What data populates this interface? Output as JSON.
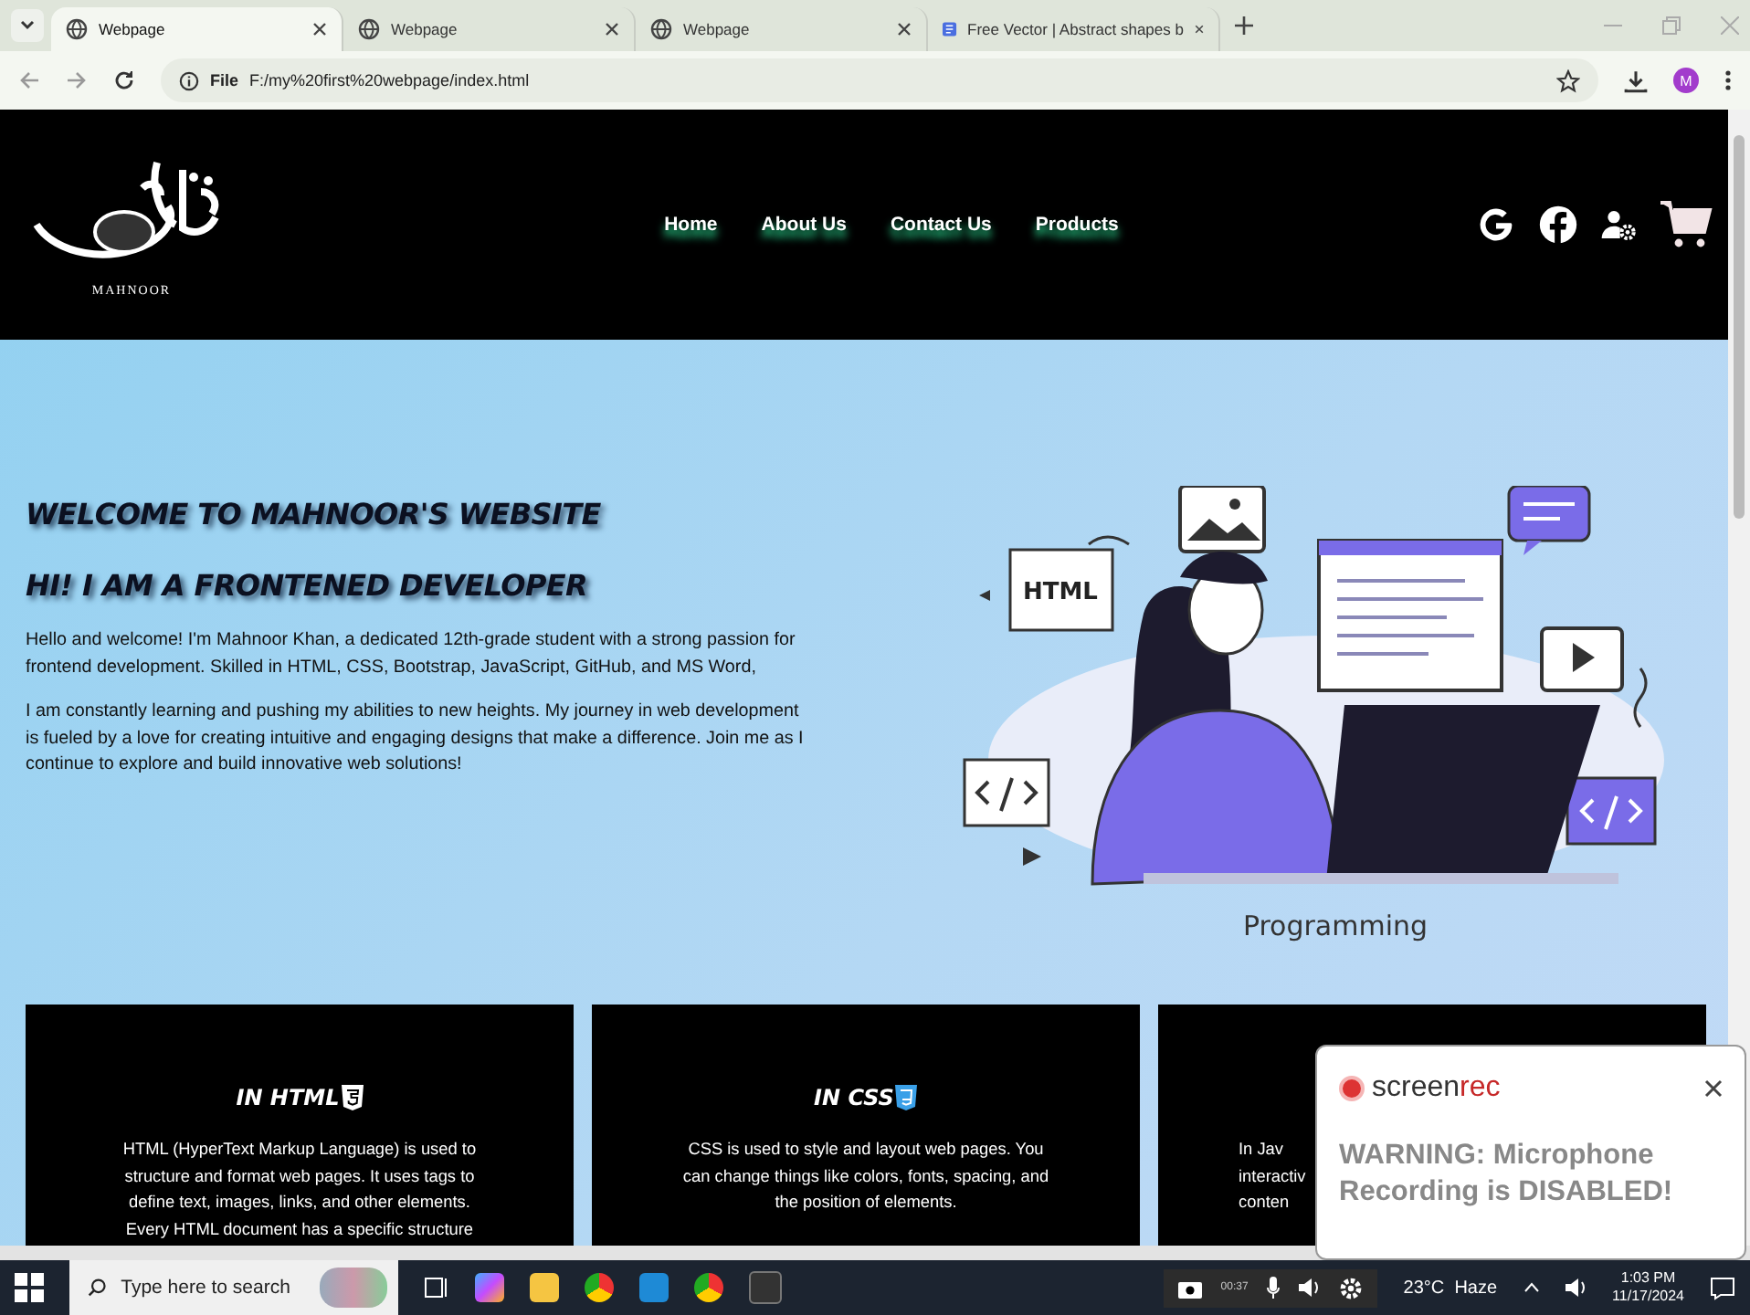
{
  "browser": {
    "tabs": [
      {
        "title": "Webpage",
        "selected": true,
        "kind": "globe"
      },
      {
        "title": "Webpage",
        "selected": false,
        "kind": "globe"
      },
      {
        "title": "Webpage",
        "selected": false,
        "kind": "globe"
      },
      {
        "title": "Free Vector | Abstract shapes b",
        "selected": false,
        "kind": "doc"
      }
    ],
    "scheme": "File",
    "url": "F:/my%20first%20webpage/index.html",
    "profile": "M"
  },
  "header": {
    "logo_caption": "MAHNOOR",
    "nav": [
      "Home",
      "About Us",
      "Contact Us",
      "Products"
    ]
  },
  "hero": {
    "title": "WELCOME TO MAHNOOR'S WEBSITE",
    "subtitle": "HI! I AM A FRONTENED DEVELOPER",
    "paragraphs": [
      "Hello and welcome! I'm Mahnoor Khan, a dedicated 12th-grade student with a strong passion for frontend development. Skilled in HTML, CSS, Bootstrap, JavaScript, GitHub, and MS Word,",
      "I am constantly learning and pushing my abilities to new heights. My journey in web development is fueled by a love for creating intuitive and engaging designs that make a difference. Join me as I continue to explore and build innovative web solutions!"
    ],
    "illustration_label": "HTML",
    "illustration_caption": "Programming"
  },
  "cards": [
    {
      "title": "IN HTML",
      "kind": "html",
      "lines": [
        "HTML (HyperText Markup Language) is used to",
        "structure and format web pages. It uses tags to",
        "define text, images, links, and other elements.",
        "Every HTML document has a specific structure"
      ]
    },
    {
      "title": "IN CSS",
      "kind": "css",
      "lines": [
        "CSS is used to style and layout web pages. You",
        "can change things like colors, fonts, spacing, and",
        "the position of elements."
      ]
    },
    {
      "lines": [
        "In Jav",
        "interactiv",
        "conten"
      ]
    }
  ],
  "popup": {
    "brand": {
      "plain": "screen",
      "accent": "rec"
    },
    "message": "WARNING: Microphone Recording is DISABLED!"
  },
  "taskbar": {
    "search_placeholder": "Type here to search",
    "timer": "00:37",
    "weather": "23°C  Haze",
    "time": "1:03 PM",
    "date": "11/17/2024"
  }
}
